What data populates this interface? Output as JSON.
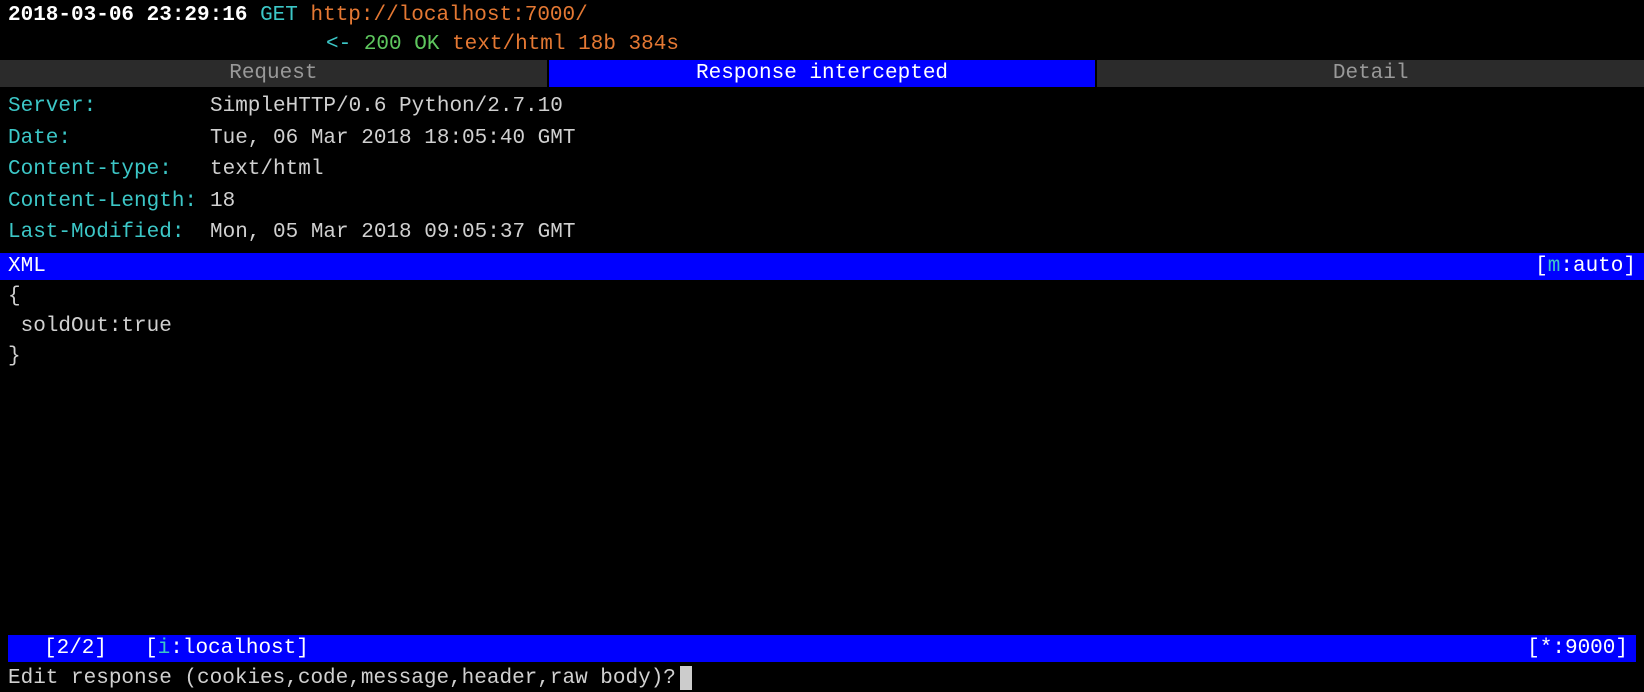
{
  "request": {
    "timestamp": "2018-03-06 23:29:16",
    "method": "GET",
    "url": "http://localhost:7000/"
  },
  "response": {
    "arrow": "<-",
    "status_code": "200",
    "status_text": "OK",
    "content_type": "text/html",
    "size": "18b",
    "duration": "384s"
  },
  "tabs": {
    "request": "Request",
    "response": "Response intercepted",
    "detail": "Detail"
  },
  "headers": [
    {
      "key": "Server:",
      "value": "SimpleHTTP/0.6 Python/2.7.10"
    },
    {
      "key": "Date:",
      "value": "Tue, 06 Mar 2018 18:05:40 GMT"
    },
    {
      "key": "Content-type:",
      "value": "text/html"
    },
    {
      "key": "Content-Length:",
      "value": "18"
    },
    {
      "key": "Last-Modified:",
      "value": "Mon, 05 Mar 2018 09:05:37 GMT"
    }
  ],
  "body": {
    "type_label": "XML",
    "mode_prefix": "[",
    "mode_key": "m",
    "mode_sep": ":",
    "mode_value": "auto",
    "mode_suffix": "]",
    "content": "{\n soldOut:true\n}"
  },
  "status": {
    "flow_count": "[2/2]",
    "filter_prefix": "[",
    "filter_key": "i",
    "filter_sep": ":",
    "filter_value": "localhost",
    "filter_suffix": "]",
    "port": "[*:9000]"
  },
  "prompt": {
    "text": "Edit response (cookies,code,message,header,raw body)?"
  }
}
